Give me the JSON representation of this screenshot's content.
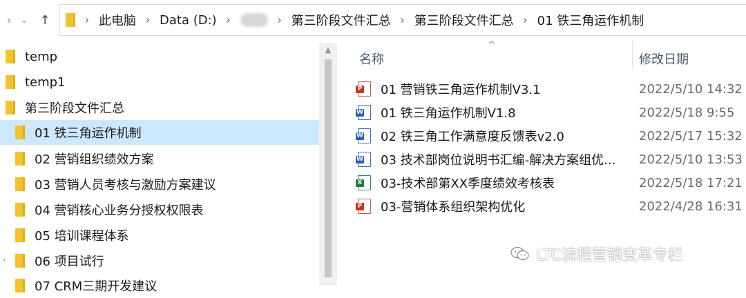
{
  "address_bar": {
    "crumbs": [
      "此电脑",
      "Data (D:)",
      "第三阶段文件汇总",
      "第三阶段文件汇总",
      "01 铁三角运作机制"
    ]
  },
  "nav_pane": {
    "items": [
      {
        "label": "temp",
        "selected": false
      },
      {
        "label": "temp1",
        "selected": false
      },
      {
        "label": "第三阶段文件汇总",
        "selected": false
      },
      {
        "label": "01 铁三角运作机制",
        "selected": true
      },
      {
        "label": "02 营销组织绩效方案",
        "selected": false
      },
      {
        "label": "03 营销人员考核与激励方案建议",
        "selected": false
      },
      {
        "label": "04 营销核心业务分授权权限表",
        "selected": false
      },
      {
        "label": "05 培训课程体系",
        "selected": false
      },
      {
        "label": "06 项目试行",
        "selected": false
      },
      {
        "label": "07 CRM三期开发建议",
        "selected": false
      }
    ]
  },
  "file_list": {
    "columns": {
      "name": "名称",
      "date": "修改日期"
    },
    "rows": [
      {
        "icon": "pdf",
        "name": "01 营销铁三角运作机制V3.1",
        "date": "2022/5/10 14:32"
      },
      {
        "icon": "word",
        "name": "01 铁三角运作机制V1.8",
        "date": "2022/5/18 9:55"
      },
      {
        "icon": "word",
        "name": "02 铁三角工作满意度反馈表v2.0",
        "date": "2022/5/17 15:32"
      },
      {
        "icon": "word",
        "name": "03 技术部岗位说明书汇编-解决方案组优...",
        "date": "2022/5/10 13:53"
      },
      {
        "icon": "excel",
        "name": "03-技术部第XX季度绩效考核表",
        "date": "2022/5/18 17:21"
      },
      {
        "icon": "pdf",
        "name": "03-营销体系组织架构优化",
        "date": "2022/4/28 16:31"
      }
    ]
  },
  "watermark": {
    "text": "LTC流程营销变革专栏"
  },
  "colors": {
    "selection": "#cce8ff",
    "folder": "#f2c230"
  }
}
